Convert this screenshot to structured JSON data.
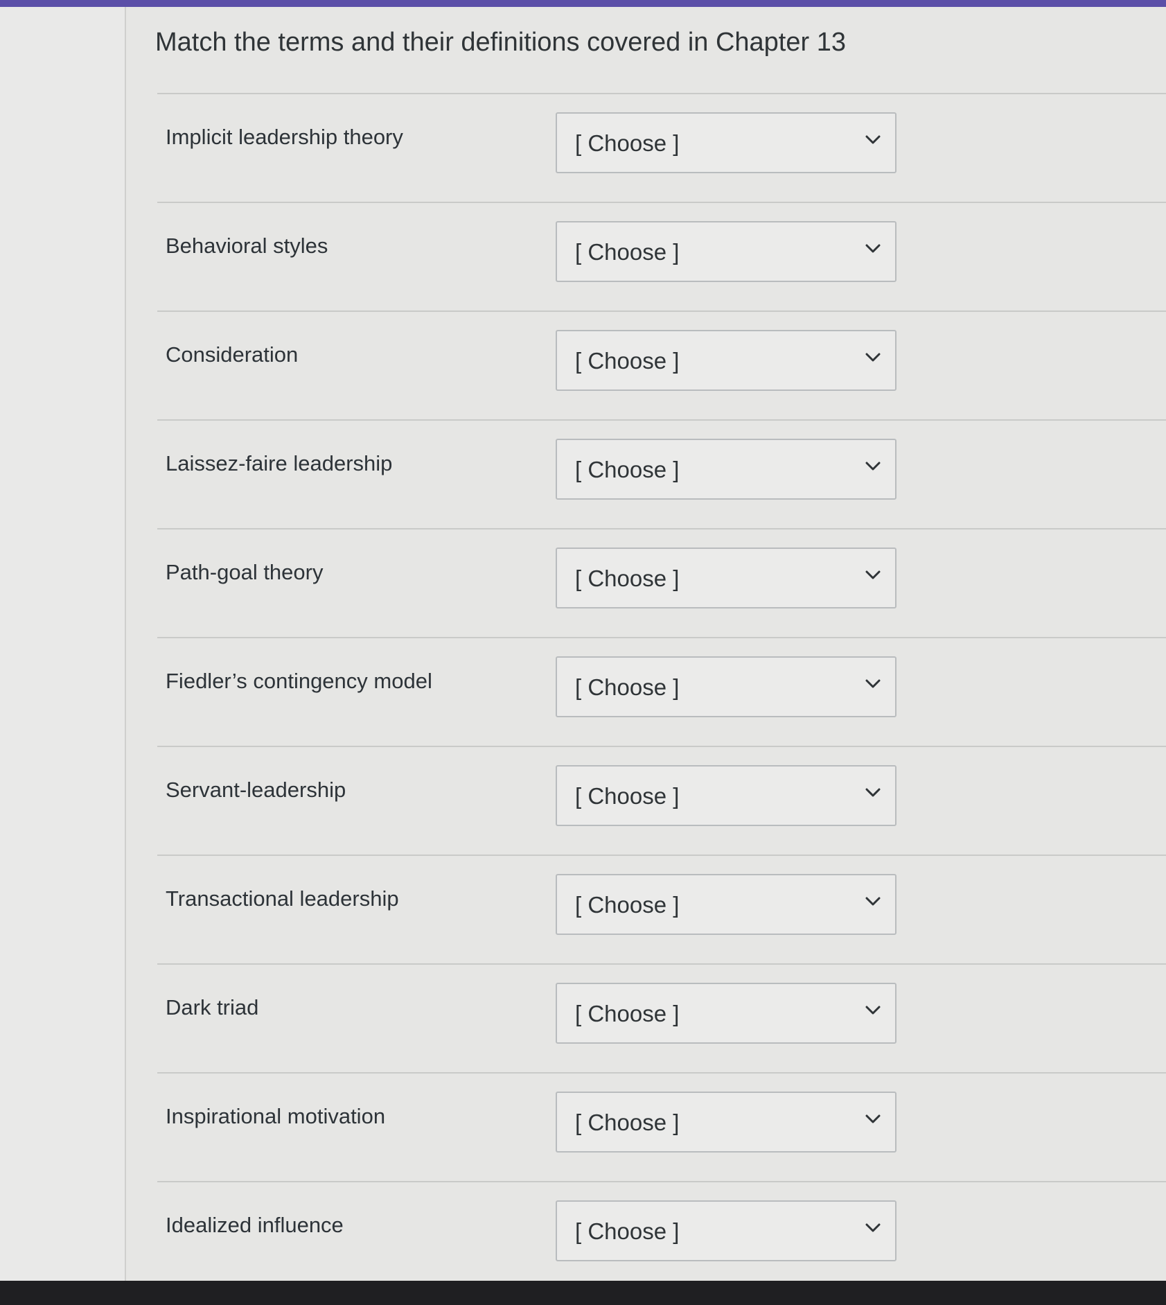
{
  "question": {
    "title": "Match the terms and their definitions covered in Chapter 13"
  },
  "rows": [
    {
      "term": "Implicit leadership theory",
      "selected": "[ Choose ]"
    },
    {
      "term": "Behavioral styles",
      "selected": "[ Choose ]"
    },
    {
      "term": "Consideration",
      "selected": "[ Choose ]"
    },
    {
      "term": "Laissez-faire leadership",
      "selected": "[ Choose ]"
    },
    {
      "term": "Path-goal theory",
      "selected": "[ Choose ]"
    },
    {
      "term": "Fiedler’s contingency model",
      "selected": "[ Choose ]"
    },
    {
      "term": "Servant-leadership",
      "selected": "[ Choose ]"
    },
    {
      "term": "Transactional leadership",
      "selected": "[ Choose ]"
    },
    {
      "term": "Dark triad",
      "selected": "[ Choose ]"
    },
    {
      "term": "Inspirational motivation",
      "selected": "[ Choose ]"
    },
    {
      "term": "Idealized influence",
      "selected": "[ Choose ]"
    }
  ],
  "icons": {
    "dropdown": "chevron-down-icon"
  },
  "colors": {
    "accent_bar": "#5b4fa8",
    "background": "#e6e6e4",
    "text": "#2d3338"
  }
}
